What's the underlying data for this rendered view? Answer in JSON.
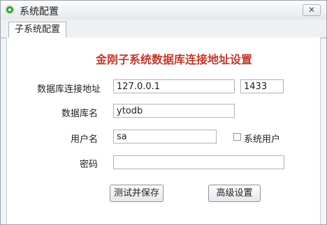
{
  "window": {
    "title": "系统配置",
    "close_label": "✕"
  },
  "tabs": [
    {
      "label": "子系统配置"
    }
  ],
  "form": {
    "heading": "金刚子系统数据库连接地址设置",
    "address_label": "数据库连接地址",
    "address_value": "127.0.0.1",
    "port_value": "1433",
    "dbname_label": "数据库名",
    "dbname_value": "ytodb",
    "user_label": "用户名",
    "user_value": "sa",
    "system_user_label": "系统用户",
    "password_label": "密码",
    "password_value": ""
  },
  "buttons": {
    "test_save": "测试并保存",
    "advanced": "高级设置"
  }
}
